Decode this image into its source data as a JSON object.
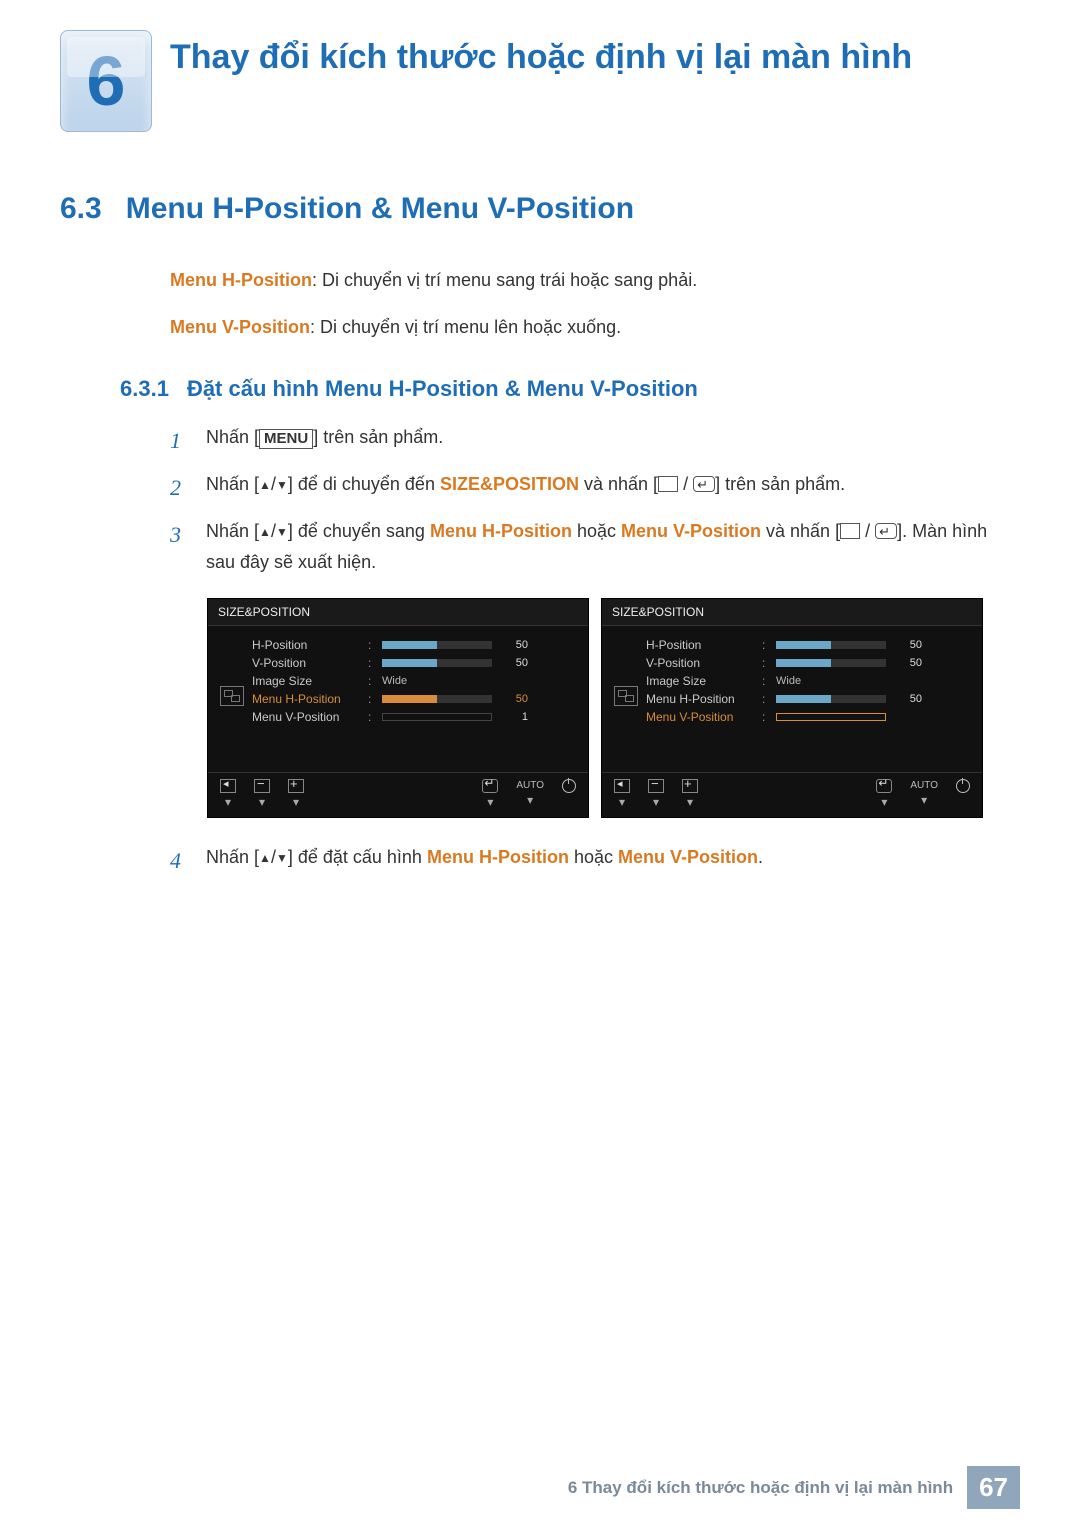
{
  "chapter": {
    "number": "6",
    "title": "Thay đổi kích thước hoặc định vị lại màn hình"
  },
  "section": {
    "number": "6.3",
    "title": "Menu H-Position & Menu V-Position"
  },
  "descriptions": {
    "h_label": "Menu H-Position",
    "h_text": ": Di chuyển vị trí menu sang trái hoặc sang phải.",
    "v_label": "Menu V-Position",
    "v_text": ": Di chuyển vị trí menu lên hoặc xuống."
  },
  "subsection": {
    "number": "6.3.1",
    "title": "Đặt cấu hình Menu H-Position & Menu V-Position"
  },
  "steps": {
    "s1_a": "Nhấn [",
    "s1_menu": "MENU",
    "s1_b": "] trên sản phẩm.",
    "s2_a": "Nhấn [",
    "s2_b": "] để di chuyển đến ",
    "s2_sp": "SIZE&POSITION",
    "s2_c": " và nhấn [",
    "s2_d": "] trên sản phẩm.",
    "s3_a": "Nhấn [",
    "s3_b": "] để chuyển sang ",
    "s3_h": "Menu H-Position",
    "s3_or": " hoặc ",
    "s3_v": "Menu V-Position",
    "s3_c": " và nhấn [",
    "s3_d": "]. Màn hình sau đây sẽ xuất hiện.",
    "s4_a": "Nhấn [",
    "s4_b": "] để đặt cấu hình ",
    "s4_h": "Menu H-Position",
    "s4_or": " hoặc ",
    "s4_v": "Menu V-Position",
    "s4_c": "."
  },
  "osd": {
    "title": "SIZE&POSITION",
    "items": {
      "hpos": "H-Position",
      "vpos": "V-Position",
      "imgsize": "Image Size",
      "imgsize_val": "Wide",
      "mhpos": "Menu H-Position",
      "mvpos": "Menu V-Position"
    },
    "left": {
      "hpos": "50",
      "vpos": "50",
      "mhpos": "50",
      "mvpos": "1"
    },
    "right": {
      "hpos": "50",
      "vpos": "50",
      "mhpos": "50",
      "mvpos": ""
    },
    "auto": "AUTO"
  },
  "footer": {
    "text": "6 Thay đổi kích thước hoặc định vị lại màn hình",
    "page": "67"
  }
}
